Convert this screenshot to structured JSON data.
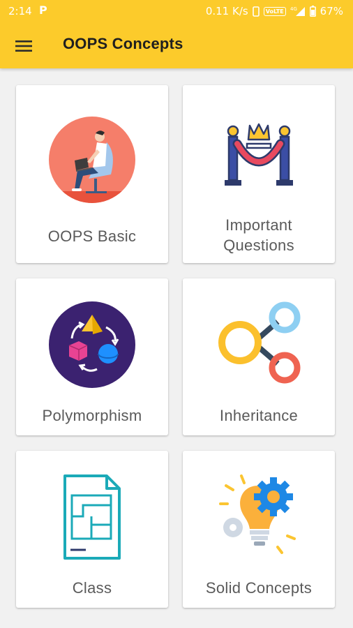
{
  "status_bar": {
    "time": "2:14",
    "notification": "P",
    "network_speed": "0.11 K/s",
    "volte": "VoLTE",
    "battery": "67%"
  },
  "toolbar": {
    "menu_icon": "hamburger-menu-icon",
    "title": "OOPS Concepts",
    "background_color": "#fccb2b"
  },
  "cards": [
    {
      "label": "OOPS Basic",
      "icon": "person-with-laptop-icon"
    },
    {
      "label": "Important Questions",
      "icon": "crown-rope-barrier-icon"
    },
    {
      "label": "Polymorphism",
      "icon": "shapes-cycle-icon"
    },
    {
      "label": "Inheritance",
      "icon": "connected-circles-icon"
    },
    {
      "label": "Class",
      "icon": "blueprint-document-icon"
    },
    {
      "label": "Solid Concepts",
      "icon": "lightbulb-gears-icon"
    }
  ]
}
